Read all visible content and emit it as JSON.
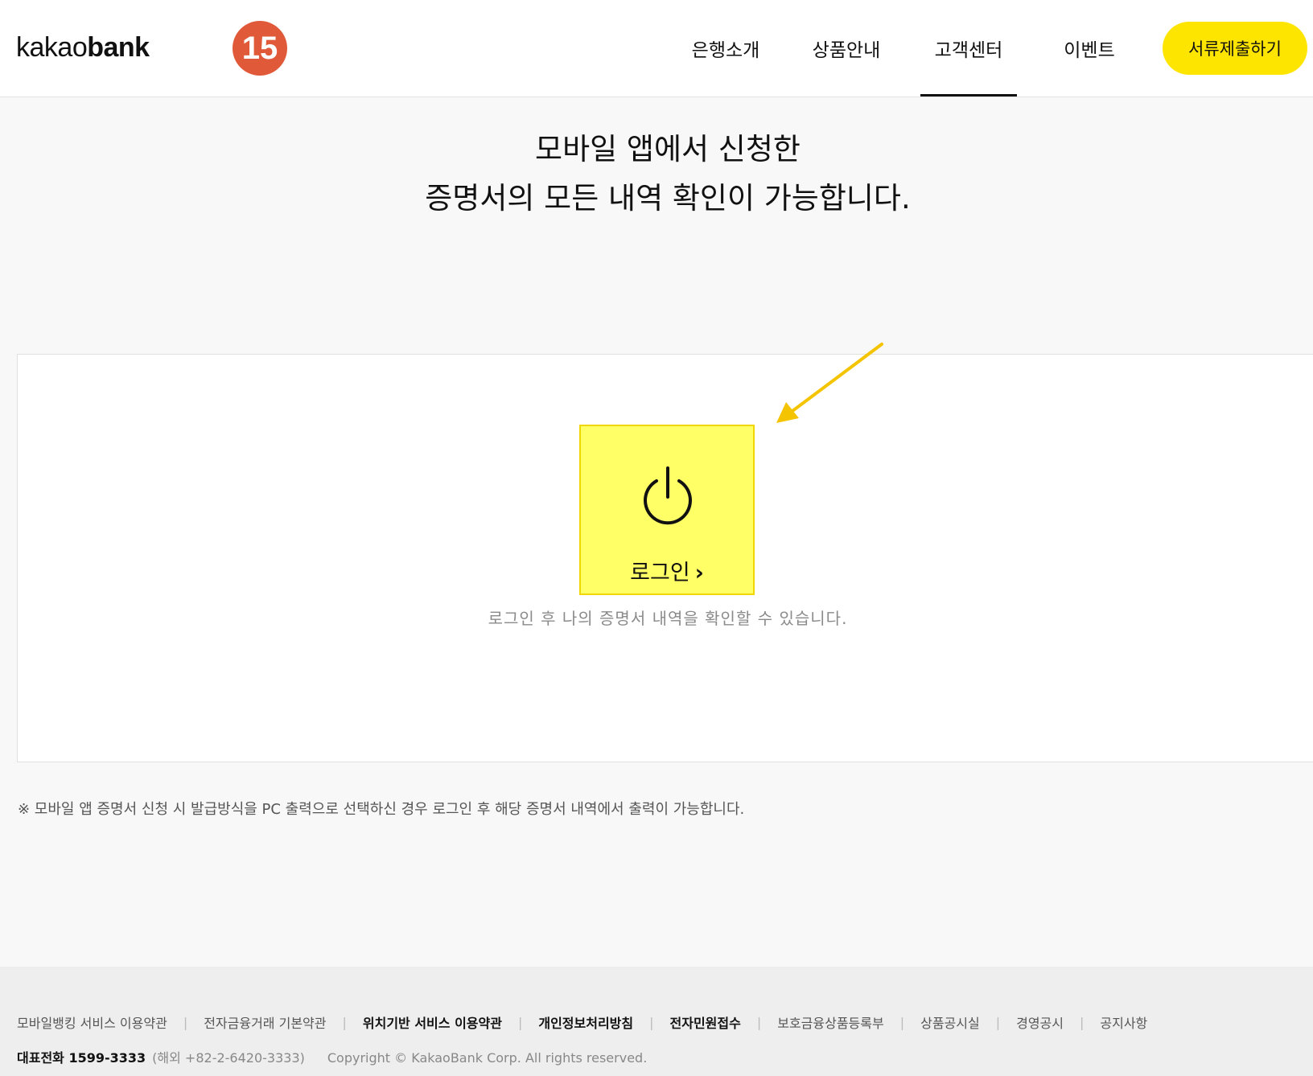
{
  "header": {
    "logo_light": "kakao",
    "logo_bold": "bank",
    "step_badge": "15",
    "nav": [
      {
        "label": "은행소개"
      },
      {
        "label": "상품안내"
      },
      {
        "label": "고객센터",
        "active": true
      },
      {
        "label": "이벤트"
      }
    ],
    "cta_label": "서류제출하기"
  },
  "main": {
    "headline_line1": "모바일 앱에서 신청한",
    "headline_line2": "증명서의 모든 내역 확인이 가능합니다.",
    "login_label": "로그인",
    "login_chevron": "›",
    "login_hint": "로그인 후 나의 증명서 내역을 확인할 수 있습니다.",
    "notice": "※ 모바일 앱 증명서 신청 시 발급방식을 PC 출력으로 선택하신 경우 로그인 후 해당 증명서 내역에서 출력이 가능합니다.",
    "icons": {
      "login": "power-icon",
      "annotation": "arrow-icon"
    }
  },
  "footer": {
    "links": [
      {
        "label": "모바일뱅킹 서비스 이용약관",
        "strong": false
      },
      {
        "label": "전자금융거래 기본약관",
        "strong": false
      },
      {
        "label": "위치기반 서비스 이용약관",
        "strong": true
      },
      {
        "label": "개인정보처리방침",
        "strong": true
      },
      {
        "label": "전자민원접수",
        "strong": true
      },
      {
        "label": "보호금융상품등록부",
        "strong": false
      },
      {
        "label": "상품공시실",
        "strong": false
      },
      {
        "label": "경영공시",
        "strong": false
      },
      {
        "label": "공지사항",
        "strong": false
      }
    ],
    "separator": "|",
    "phone": "대표전화 1599-3333",
    "overseas": "(해외 +82-2-6420-3333)",
    "copyright": "Copyright © KakaoBank Corp. All rights reserved."
  },
  "colors": {
    "brand_yellow": "#fee500",
    "highlight_yellow": "#ffff66",
    "badge_red": "#e05a3a",
    "arrow_yellow": "#f5c400"
  }
}
